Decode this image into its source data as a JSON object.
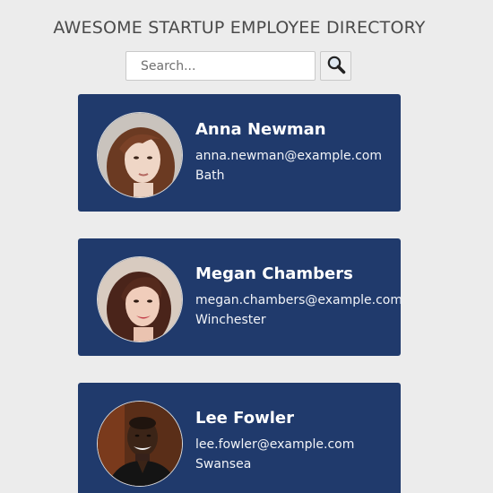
{
  "header": {
    "title": "AWESOME STARTUP EMPLOYEE DIRECTORY"
  },
  "search": {
    "placeholder": "Search...",
    "value": "",
    "button_icon": "magnifier-icon"
  },
  "colors": {
    "background": "#ececec",
    "card": "#203a6c",
    "title": "#4a4a4a",
    "card_text": "#ffffff"
  },
  "employees": [
    {
      "name": "Anna Newman",
      "email": "anna.newman@example.com",
      "city": "Bath"
    },
    {
      "name": "Megan Chambers",
      "email": "megan.chambers@example.com",
      "city": "Winchester"
    },
    {
      "name": "Lee Fowler",
      "email": "lee.fowler@example.com",
      "city": "Swansea"
    }
  ]
}
